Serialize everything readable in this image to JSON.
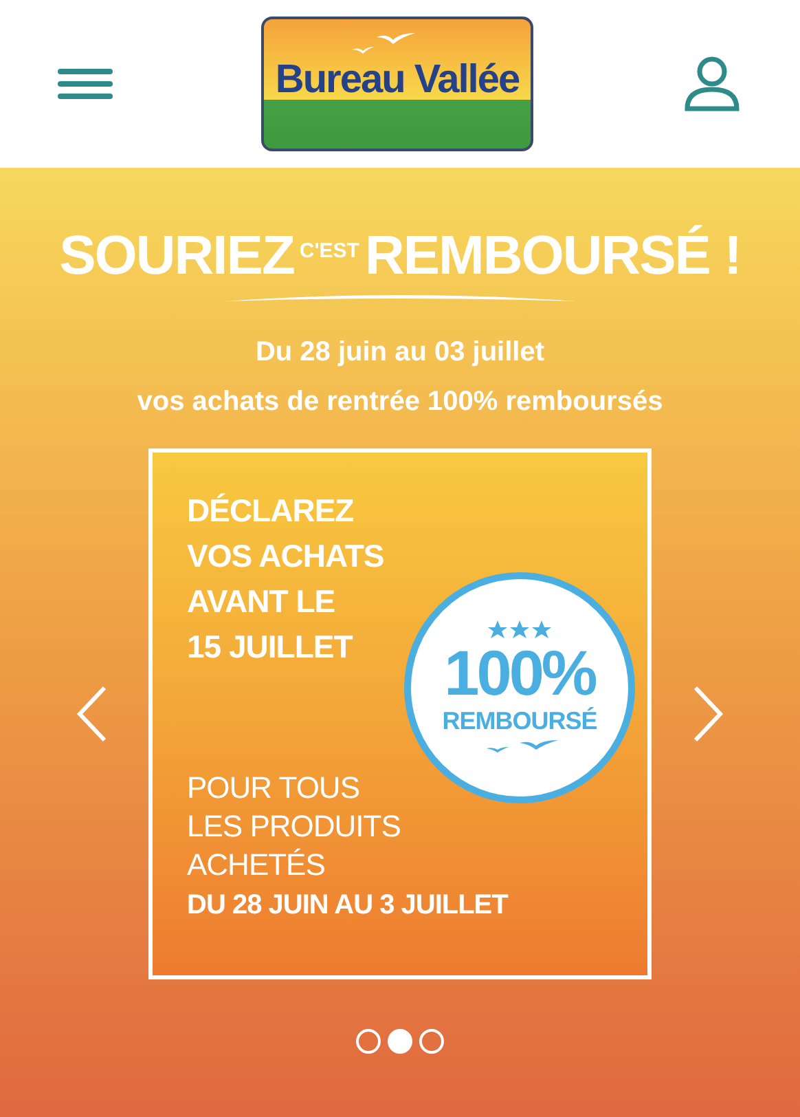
{
  "header": {
    "logo": {
      "brand": "Bureau Vallée"
    }
  },
  "hero": {
    "headline": {
      "start": "SOURIEZ",
      "small": "C'EST",
      "end": "REMBOURSÉ !"
    },
    "subtitle": [
      "Du 28 juin au 03 juillet",
      "vos achats de rentrée 100% remboursés"
    ]
  },
  "slide": {
    "top_lines": [
      "DÉCLAREZ",
      "VOS ACHATS",
      "AVANT LE",
      "15 JUILLET"
    ],
    "stamp": {
      "percent": "100%",
      "label": "REMBOURSÉ"
    },
    "bottom_lines": [
      "POUR TOUS",
      "LES PRODUITS",
      "ACHETÉS"
    ],
    "dates": "DU 28 JUIN AU 3 JUILLET"
  },
  "dots": [
    {
      "selected": false
    },
    {
      "selected": true
    },
    {
      "selected": false
    }
  ]
}
